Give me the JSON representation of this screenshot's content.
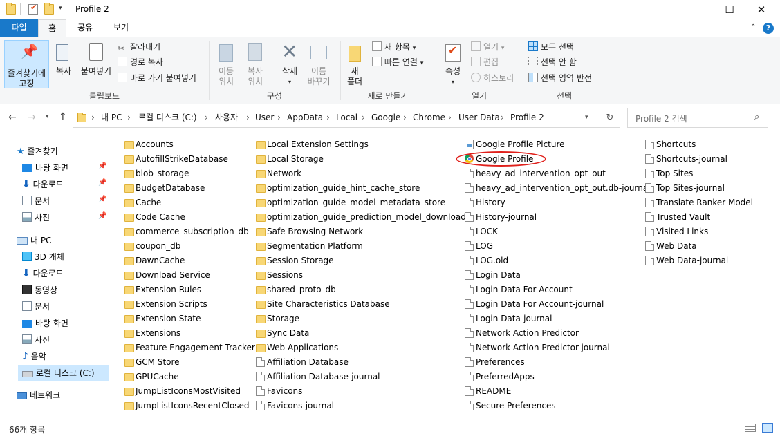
{
  "window": {
    "title": "Profile 2",
    "minimize": "—",
    "maximize": "☐",
    "close": "✕"
  },
  "tabs": {
    "file": "파일",
    "home": "홈",
    "share": "공유",
    "view": "보기"
  },
  "ribbon": {
    "clipboard": {
      "pin_l1": "즐겨찾기에",
      "pin_l2": "고정",
      "copy": "복사",
      "paste": "붙여넣기",
      "cut": "잘라내기",
      "copy_path": "경로 복사",
      "paste_shortcut": "바로 가기 붙여넣기",
      "label": "클립보드"
    },
    "organize": {
      "move_l1": "이동",
      "move_l2": "위치",
      "copyto_l1": "복사",
      "copyto_l2": "위치",
      "delete": "삭제",
      "rename_l1": "이름",
      "rename_l2": "바꾸기",
      "label": "구성"
    },
    "new": {
      "folder_l1": "새",
      "folder_l2": "폴더",
      "new_item": "새 항목",
      "easy_access": "빠른 연결",
      "label": "새로 만들기"
    },
    "open": {
      "properties": "속성",
      "open": "열기",
      "edit": "편집",
      "history": "히스토리",
      "label": "열기"
    },
    "select": {
      "select_all": "모두 선택",
      "select_none": "선택 안 함",
      "invert": "선택 영역 반전",
      "label": "선택"
    }
  },
  "address": {
    "crumbs": [
      "내 PC",
      "로컬 디스크 (C:)",
      "사용자",
      "User",
      "AppData",
      "Local",
      "Google",
      "Chrome",
      "User Data",
      "Profile 2"
    ],
    "search_placeholder": "Profile 2 검색"
  },
  "nav": {
    "quick_access": "즐겨찾기",
    "qa_items": [
      "바탕 화면",
      "다운로드",
      "문서",
      "사진"
    ],
    "this_pc": "내 PC",
    "pc_items": [
      "3D 개체",
      "다운로드",
      "동영상",
      "문서",
      "바탕 화면",
      "사진",
      "음악",
      "로컬 디스크 (C:)"
    ],
    "network": "네트워크"
  },
  "files": {
    "col1": [
      "Accounts",
      "AutofillStrikeDatabase",
      "blob_storage",
      "BudgetDatabase",
      "Cache",
      "Code Cache",
      "commerce_subscription_db",
      "coupon_db",
      "DawnCache",
      "Download Service",
      "Extension Rules",
      "Extension Scripts",
      "Extension State",
      "Extensions",
      "Feature Engagement Tracker",
      "GCM Store",
      "GPUCache",
      "JumpListIconsMostVisited",
      "JumpListIconsRecentClosed"
    ],
    "col2": [
      "Local Extension Settings",
      "Local Storage",
      "Network",
      "optimization_guide_hint_cache_store",
      "optimization_guide_model_metadata_store",
      "optimization_guide_prediction_model_downloads",
      "Safe Browsing Network",
      "Segmentation Platform",
      "Session Storage",
      "Sessions",
      "shared_proto_db",
      "Site Characteristics Database",
      "Storage",
      "Sync Data",
      "Web Applications",
      "Affiliation Database",
      "Affiliation Database-journal",
      "Favicons",
      "Favicons-journal"
    ],
    "col3": [
      "Google Profile Picture",
      "Google Profile",
      "heavy_ad_intervention_opt_out",
      "heavy_ad_intervention_opt_out.db-journal",
      "History",
      "History-journal",
      "LOCK",
      "LOG",
      "LOG.old",
      "Login Data",
      "Login Data For Account",
      "Login Data For Account-journal",
      "Login Data-journal",
      "Network Action Predictor",
      "Network Action Predictor-journal",
      "Preferences",
      "PreferredApps",
      "README",
      "Secure Preferences"
    ],
    "col4": [
      "Shortcuts",
      "Shortcuts-journal",
      "Top Sites",
      "Top Sites-journal",
      "Translate Ranker Model",
      "Trusted Vault",
      "Visited Links",
      "Web Data",
      "Web Data-journal"
    ],
    "col1_icons": [
      "folder",
      "folder",
      "folder",
      "folder",
      "folder",
      "folder",
      "folder",
      "folder",
      "folder",
      "folder",
      "folder",
      "folder",
      "folder",
      "folder",
      "folder",
      "folder",
      "folder",
      "folder",
      "folder"
    ],
    "col2_icons": [
      "folder",
      "folder",
      "folder",
      "folder",
      "folder",
      "folder",
      "folder",
      "folder",
      "folder",
      "folder",
      "folder",
      "folder",
      "folder",
      "folder",
      "folder",
      "file",
      "file",
      "file",
      "file"
    ],
    "col3_icons": [
      "image",
      "chrome",
      "file",
      "file",
      "file",
      "file",
      "file",
      "file",
      "file",
      "file",
      "file",
      "file",
      "file",
      "file",
      "file",
      "file",
      "file",
      "file",
      "file"
    ],
    "col4_icons": [
      "file",
      "file",
      "file",
      "file",
      "file",
      "file",
      "file",
      "file",
      "file"
    ]
  },
  "status": {
    "count": "66개 항목"
  },
  "colors": {
    "accent": "#1979ca",
    "selection": "#cce8ff",
    "folder": "#f8d775",
    "highlight_ring": "#e0201b"
  }
}
